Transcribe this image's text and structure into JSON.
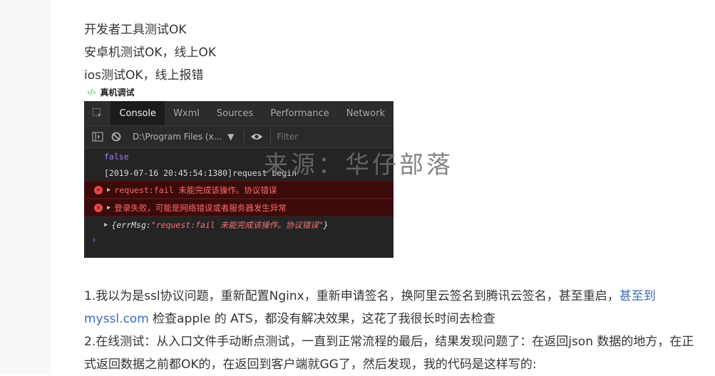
{
  "intro_lines": [
    "开发者工具测试OK",
    "安卓机测试OK，线上OK",
    "ios测试OK，线上报错"
  ],
  "caption": {
    "icon": "‹/›",
    "text": "真机调试"
  },
  "devtools": {
    "tabs": [
      "Console",
      "Wxml",
      "Sources",
      "Performance",
      "Network"
    ],
    "active_tab": "Console",
    "context": "D:\\Program Files (x...",
    "filter_placeholder": "Filter",
    "logs": {
      "bool": "false",
      "request": "[2019-07-16 20:45:54:1380]request begin",
      "err1": "request:fail 未能完成该操作。协议错误",
      "err2": "登录失败，可能是网络错误或者服务器发生异常",
      "obj_key": "{errMsg: ",
      "obj_val": "\"request:fail 未能完成该操作。协议错误\"",
      "obj_end": "}"
    }
  },
  "watermark": "来源：华仔部落",
  "para1_a": "1.我以为是ssl协议问题，重新配置Nginx，重新申请签名，换阿里云签名到腾讯云签名，甚至重启，",
  "para1_link": "甚至到myssl.com",
  "para1_b": " 检查apple 的 ATS，都没有解决效果，这花了我很长时间去检查",
  "para2": "2.在线测试：从入口文件手动断点测试，一直到正常流程的最后，结果发现问题了：在返回json 数据的地方，在正式返回数据之前都OK的，在返回到客户端就GG了，然后发现，我的代码是这样写的:"
}
